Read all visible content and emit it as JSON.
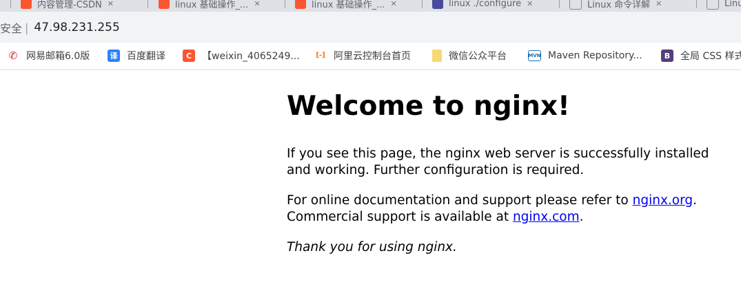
{
  "tabs": [
    {
      "label": "内容管理-CSDN",
      "icon": "csdn-icon",
      "color": "#fc5531"
    },
    {
      "label": "linux 基础操作_...",
      "icon": "csdn-icon",
      "color": "#fc5531"
    },
    {
      "label": "linux 基础操作_...",
      "icon": "csdn-icon",
      "color": "#fc5531"
    },
    {
      "label": "linux ./configure",
      "icon": "page-icon",
      "color": "#4a4a9c"
    },
    {
      "label": "Linux 命令详解",
      "icon": "page-icon",
      "color": "#888888"
    },
    {
      "label": "Linu",
      "icon": "page-icon",
      "color": "#888888"
    }
  ],
  "address_bar": {
    "security_label": "安全",
    "url": "47.98.231.255"
  },
  "bookmarks": [
    {
      "label": "网易邮箱6.0版",
      "icon": "netease-mail-icon",
      "glyph": "✆",
      "color": "#e02020"
    },
    {
      "label": "百度翻译",
      "icon": "baidu-translate-icon",
      "glyph": "译",
      "color": "#2c80ff"
    },
    {
      "label": "【weixin_4065249...",
      "icon": "csdn-icon",
      "glyph": "C",
      "color": "#fc5531"
    },
    {
      "label": "阿里云控制台首页",
      "icon": "aliyun-icon",
      "glyph": "[-]",
      "color": "#ff6a00"
    },
    {
      "label": "微信公众平台",
      "icon": "folder-icon",
      "glyph": "",
      "color": "#f8d775"
    },
    {
      "label": "Maven Repository...",
      "icon": "maven-icon",
      "glyph": "MVN",
      "color": "#1c6fb5"
    },
    {
      "label": "全局 CSS 样式",
      "icon": "bootstrap-icon",
      "glyph": "B",
      "color": "#563d7c"
    }
  ],
  "page": {
    "heading": "Welcome to nginx!",
    "p1": "If you see this page, the nginx web server is successfully installed and working. Further configuration is required.",
    "p2_prefix": "For online documentation and support please refer to ",
    "link_org": "nginx.org",
    "p2_middle": ".",
    "p2_line2": "Commercial support is available at ",
    "link_com": "nginx.com",
    "p2_suffix": ".",
    "thanks": "Thank you for using nginx."
  }
}
